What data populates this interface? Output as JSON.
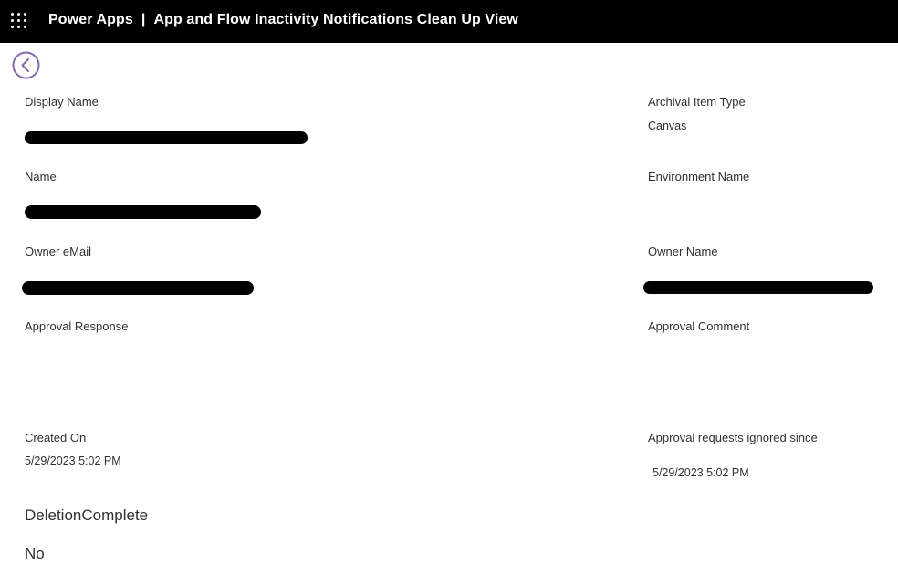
{
  "topbar": {
    "app_name": "Power Apps",
    "separator": "|",
    "view_title": "App and Flow Inactivity Notifications Clean Up View",
    "waffle_icon": "waffle-icon"
  },
  "nav": {
    "back_icon": "chevron-left-circle-icon",
    "accent_color": "#8764b8"
  },
  "fields": {
    "display_name": {
      "label": "Display Name",
      "value": ""
    },
    "archival_item_type": {
      "label": "Archival Item Type",
      "value": "Canvas"
    },
    "name": {
      "label": "Name",
      "value": ""
    },
    "environment_name": {
      "label": "Environment Name",
      "value": ""
    },
    "owner_email": {
      "label": "Owner eMail",
      "value": ""
    },
    "owner_name": {
      "label": "Owner Name",
      "value": ""
    },
    "approval_response": {
      "label": "Approval Response",
      "value": ""
    },
    "approval_comment": {
      "label": "Approval Comment",
      "value": ""
    },
    "created_on": {
      "label": "Created On",
      "value": "5/29/2023 5:02 PM"
    },
    "approval_ignored_since": {
      "label": "Approval requests ignored since",
      "value": "5/29/2023 5:02 PM"
    },
    "deletion_complete": {
      "label": "DeletionComplete",
      "value": "No"
    }
  }
}
